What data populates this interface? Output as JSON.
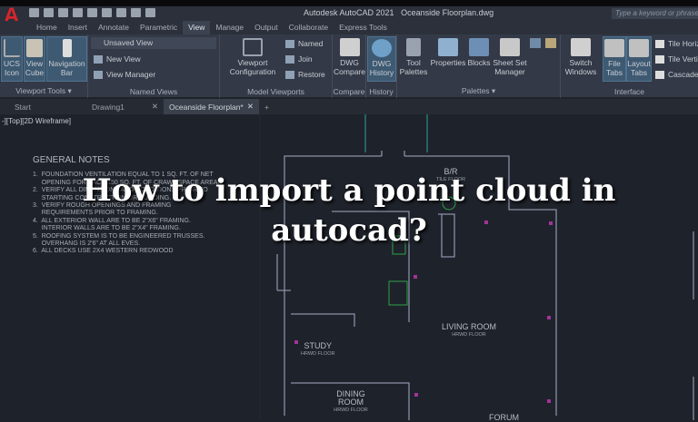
{
  "app": {
    "title": "Autodesk AutoCAD 2021",
    "file": "Oceanside Floorplan.dwg",
    "search_placeholder": "Type a keyword or phrase",
    "logo": "A"
  },
  "ribbon_tabs": [
    {
      "label": "Home"
    },
    {
      "label": "Insert"
    },
    {
      "label": "Annotate"
    },
    {
      "label": "Parametric"
    },
    {
      "label": "View",
      "active": true
    },
    {
      "label": "Manage"
    },
    {
      "label": "Output"
    },
    {
      "label": "Collaborate"
    },
    {
      "label": "Express Tools"
    }
  ],
  "groups": {
    "viewport_tools": {
      "label": "Viewport Tools ▾",
      "ucs": "UCS Icon",
      "viewcube": "View Cube",
      "navbar": "Navigation Bar"
    },
    "named_views": {
      "label": "Named Views",
      "dropdown": "Unsaved View",
      "new_view": "New View",
      "view_manager": "View Manager"
    },
    "model_viewports": {
      "label": "Model Viewports",
      "config": "Viewport Configuration",
      "named": "Named",
      "join": "Join",
      "restore": "Restore"
    },
    "compare": {
      "label": "Compare",
      "dwg_compare": "DWG Compare"
    },
    "history": {
      "label": "History",
      "dwg_history": "DWG History"
    },
    "palettes": {
      "label": "Palettes ▾",
      "tool_palettes": "Tool Palettes",
      "properties": "Properties",
      "blocks": "Blocks",
      "sheet_set": "Sheet Set Manager"
    },
    "interface": {
      "label": "Interface",
      "switch_windows": "Switch Windows",
      "file_tabs": "File Tabs",
      "layout_tabs": "Layout Tabs",
      "tile_h": "Tile Horizontally",
      "tile_v": "Tile Vertically",
      "cascade": "Cascade"
    }
  },
  "file_tabs": [
    {
      "label": "Start"
    },
    {
      "label": "Drawing1"
    },
    {
      "label": "Oceanside Floorplan*",
      "active": true
    }
  ],
  "viewport_label": "-][Top][2D Wireframe]",
  "notes": {
    "title": "GENERAL NOTES",
    "items": [
      "1.  FOUNDATION VENTILATION EQUAL TO 1 SQ. FT. OF NET",
      "     OPENING FOR EACH 150 SQ. FT. OF CRAWL SPACE AREA.",
      "2.  VERIFY ALL DIMENSIONS AND CONDITIONS PRIOR TO",
      "     STARTING CONSTRUCTION OR BUILDING.",
      "3.  VERIFY ROUGH OPENINGS AND FRAMING",
      "     REQUIREMENTS PRIOR TO FRAMING.",
      "4.  ALL EXTERIOR WALL ARE TO BE 2\"X6\" FRAMING.",
      "     INTERIOR WALLS ARE TO BE 2\"X4\" FRAMING.",
      "5.  ROOFING SYSTEM IS TO BE ENGINEERED TRUSSES.",
      "     OVERHANG IS 2'6\" AT ALL EVES.",
      "6.  ALL DECKS USE 2X4 WESTERN REDWOOD"
    ]
  },
  "rooms": [
    {
      "name": "B/R",
      "floor": "TILE FLOOR"
    },
    {
      "name": "LIVING ROOM",
      "floor": "HRWD FLOOR"
    },
    {
      "name": "STUDY",
      "floor": "HRWD FLOOR"
    },
    {
      "name": "DINING ROOM",
      "floor": "HRWD FLOOR"
    },
    {
      "name": "FORUM",
      "floor": ""
    }
  ],
  "overlay_title": {
    "line1": "How to import a point cloud in",
    "line2": "autocad?"
  },
  "colors": {
    "wall": "#8a8fa8",
    "accent_green": "#2fa24a",
    "accent_magenta": "#a0339a",
    "canvas": "#1e222a",
    "logo": "#d9252b"
  }
}
